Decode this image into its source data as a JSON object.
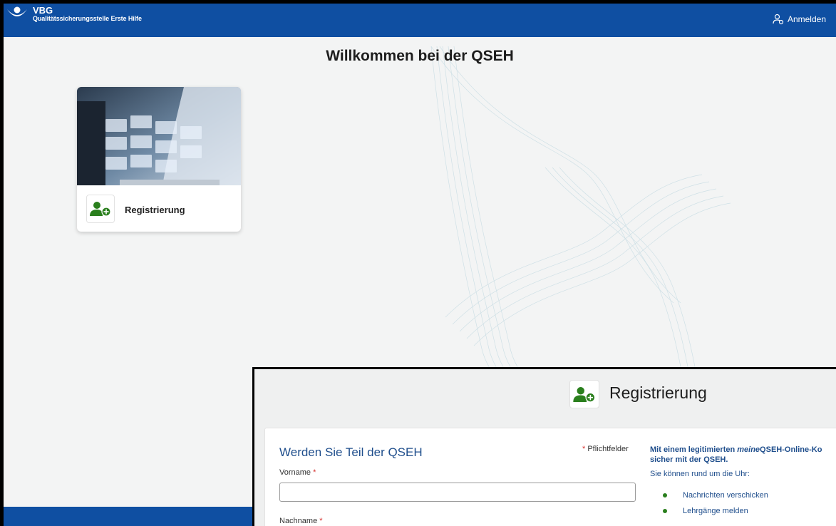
{
  "header": {
    "brand_name": "VBG",
    "brand_subtitle": "Qualitätssicherungsstelle Erste Hilfe",
    "login_label": "Anmelden"
  },
  "main": {
    "title": "Willkommen bei der QSEH",
    "card": {
      "label": "Registrierung"
    }
  },
  "overlay": {
    "title": "Registrierung",
    "form": {
      "heading": "Werden Sie Teil der QSEH",
      "required_star": "*",
      "required_note": "Pflichtfelder",
      "fields": [
        {
          "label": "Vorname",
          "value": ""
        },
        {
          "label": "Nachname"
        }
      ]
    },
    "info": {
      "heading_pre": "Mit einem legitimierten ",
      "heading_emph": "meine",
      "heading_post": "QSEH-Online-Ko",
      "heading_line2": "sicher mit der QSEH.",
      "subtext": "Sie können rund um die Uhr:",
      "items": [
        "Nachrichten verschicken",
        "Lehrgänge melden"
      ]
    }
  },
  "colors": {
    "brand_blue": "#0f4fa2",
    "heading_blue": "#1f4e8c",
    "icon_green": "#2a7f1d",
    "required_red": "#d6322f"
  },
  "icons": {
    "logo": "vbg-logo-icon",
    "login": "user-login-icon",
    "registration": "user-add-icon"
  }
}
